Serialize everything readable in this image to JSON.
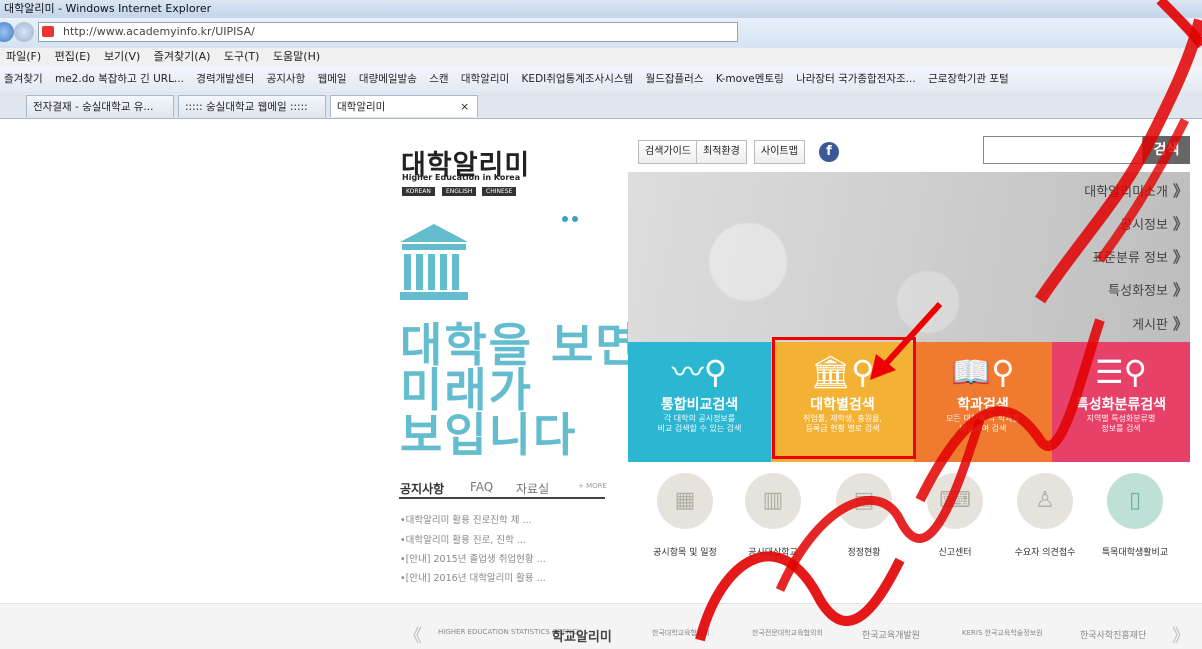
{
  "browser": {
    "title": "대학알리미 - Windows Internet Explorer",
    "url": "http://www.academyinfo.kr/UIPISA/",
    "menu": [
      "파일(F)",
      "편집(E)",
      "보기(V)",
      "즐겨찾기(A)",
      "도구(T)",
      "도움말(H)"
    ],
    "favorites_label": "즐겨찾기",
    "favorites": [
      "me2.do 복잡하고 긴 URL...",
      "경력개발센터",
      "공지사항",
      "웹메일",
      "대량메일발송",
      "스캔",
      "대학알리미",
      "KEDI취업통계조사시스템",
      "월드잡플러스",
      "K-move멘토링",
      "나라장터 국가종합전자조...",
      "근로장학기관 포털"
    ],
    "tabs": [
      "전자결재 - 숭실대학교 유...",
      "::::: 숭실대학교 웹메일 :::::",
      "대학알리미"
    ],
    "tab_close": "×"
  },
  "logo": {
    "title": "대학알리미",
    "subtitle": "Higher Education in Korea",
    "languages": [
      "KOREAN",
      "ENGLISH",
      "CHINESE"
    ]
  },
  "slogan": [
    "대학을 보면",
    "미래가",
    "보입니다"
  ],
  "top_buttons": [
    "검색가이드",
    "최적환경",
    "사이트맵"
  ],
  "facebook_glyph": "f",
  "search": {
    "placeholder": "",
    "button": "검색"
  },
  "menu_links": [
    "대학알리미소개",
    "공시정보",
    "표준분류 정보",
    "특성화정보",
    "게시판"
  ],
  "menu_chevron": "》",
  "tiles": [
    {
      "title": "통합비교검색",
      "desc1": "각 대학의 공시정보를",
      "desc2": "비교 검색할 수 있는 검색",
      "color": "#2bb6d2",
      "icon": "chart-search-icon"
    },
    {
      "title": "대학별검색",
      "desc1": "취업률, 재학생, 충원율,",
      "desc2": "등록금 현황 별로 검색",
      "color": "#f3b233",
      "icon": "university-search-icon"
    },
    {
      "title": "학과검색",
      "desc1": "모든 대학의 각 학과를",
      "desc2": "비교하여 검색",
      "color": "#ef7a30",
      "icon": "book-search-icon"
    },
    {
      "title": "특성화분류검색",
      "desc1": "지역별 특성화분류별",
      "desc2": "정보를 검색",
      "color": "#e7416a",
      "icon": "category-search-icon"
    }
  ],
  "notice": {
    "tabs": [
      "공지사항",
      "FAQ",
      "자료실"
    ],
    "more": "+ MORE",
    "items": [
      "•대학알리미 활용 진로진학 체 ...",
      "•대학알리미 활용 진로, 진학 ...",
      "•[안내] 2015년 졸업생 취업현황 ...",
      "•[안내] 2016년 대학알리미 활용 ..."
    ]
  },
  "quick_links": [
    "공시항목 및 일정",
    "공시대상학교",
    "정정현황",
    "신고센터",
    "수요자 의견접수",
    "특목대학생활비교"
  ],
  "footer": {
    "prev": "《",
    "next": "》",
    "items": [
      "HIGHER EDUCATION STATISTICS AGENCY",
      "학교알리미",
      "한국대학교육협의회",
      "한국전문대학교육협의회",
      "한국교육개발원",
      "KERIS 한국교육학술정보원",
      "한국사학진흥재단"
    ]
  },
  "annotation_color": "#e00000"
}
